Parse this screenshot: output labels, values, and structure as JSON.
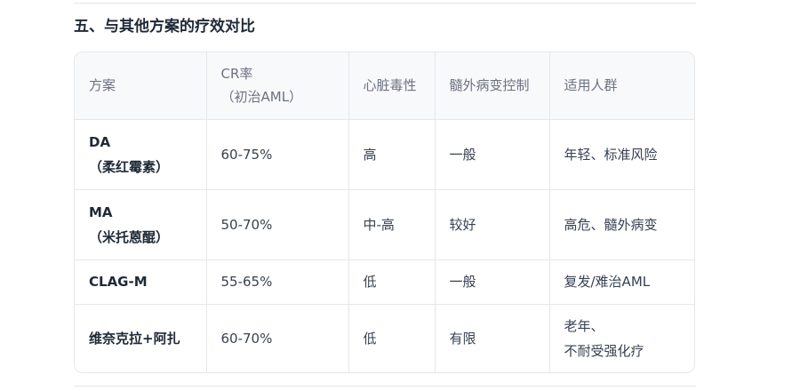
{
  "section": {
    "title": "五、与其他方案的疗效对比"
  },
  "table": {
    "headers": [
      [
        "方案"
      ],
      [
        "CR率",
        "（初治AML）"
      ],
      [
        "心脏毒性"
      ],
      [
        "髓外病变控制"
      ],
      [
        "适用人群"
      ]
    ],
    "rows": [
      {
        "scheme": [
          "DA",
          "（柔红霉素）"
        ],
        "cr": [
          "60-75%"
        ],
        "cardio": [
          "高"
        ],
        "extramedullary": [
          "一般"
        ],
        "population": [
          "年轻、标准风险"
        ]
      },
      {
        "scheme": [
          "MA",
          "（米托蒽醌）"
        ],
        "cr": [
          "50-70%"
        ],
        "cardio": [
          "中-高"
        ],
        "extramedullary": [
          "较好"
        ],
        "population": [
          "高危、髓外病变"
        ]
      },
      {
        "scheme": [
          "CLAG-M"
        ],
        "cr": [
          "55-65%"
        ],
        "cardio": [
          "低"
        ],
        "extramedullary": [
          "一般"
        ],
        "population": [
          "复发/难治AML"
        ]
      },
      {
        "scheme": [
          "维奈克拉+阿扎"
        ],
        "cr": [
          "60-70%"
        ],
        "cardio": [
          "低"
        ],
        "extramedullary": [
          "有限"
        ],
        "population": [
          "老年、",
          "不耐受强化疗"
        ]
      }
    ]
  }
}
